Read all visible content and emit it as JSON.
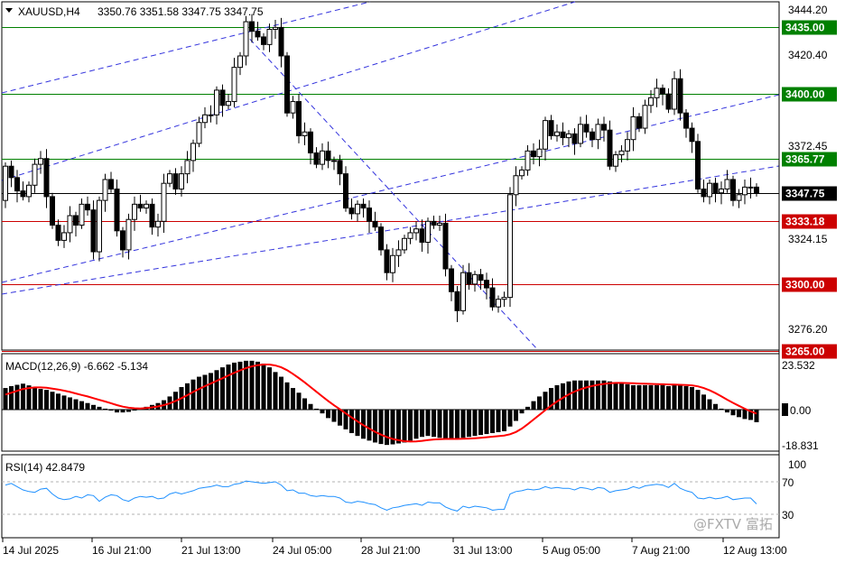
{
  "header": {
    "symbol": "XAUUSD,H4",
    "ohlc": "3350.76 3351.58 3347.75 3347.75"
  },
  "price_axis": {
    "ticks": [
      "3444.20",
      "3420.40",
      "3372.45",
      "3324.15",
      "3276.20"
    ],
    "tagged_levels": [
      {
        "label": "3435.00",
        "value": 3435.0,
        "color": "#008000"
      },
      {
        "label": "3400.00",
        "value": 3400.0,
        "color": "#008000"
      },
      {
        "label": "3365.77",
        "value": 3365.77,
        "color": "#008000"
      },
      {
        "label": "3347.75",
        "value": 3347.75,
        "color": "#000000"
      },
      {
        "label": "3333.18",
        "value": 3333.18,
        "color": "#cc0000"
      },
      {
        "label": "3300.00",
        "value": 3300.0,
        "color": "#cc0000"
      },
      {
        "label": "3265.00",
        "value": 3265.0,
        "color": "#cc0000"
      }
    ]
  },
  "macd_panel": {
    "label": "MACD(12,26,9) -6.662 -5.134",
    "ticks": [
      "23.532",
      "0.00",
      "-18.831"
    ]
  },
  "rsi_panel": {
    "label": "RSI(14) 42.8479",
    "ticks": [
      "100",
      "70",
      "30"
    ]
  },
  "time_axis": {
    "labels": [
      "14 Jul 2025",
      "16 Jul 21:00",
      "21 Jul 13:00",
      "24 Jul 05:00",
      "28 Jul 21:00",
      "31 Jul 13:00",
      "5 Aug 05:00",
      "7 Aug 21:00",
      "12 Aug 13:00"
    ]
  },
  "watermark": "@FXTV 富拓",
  "chart_data": [
    {
      "type": "candlestick",
      "title": "XAUUSD,H4",
      "ylim": [
        3260,
        3448
      ],
      "open": [
        3344,
        3362,
        3356,
        3349,
        3346,
        3352,
        3363,
        3366,
        3346,
        3331,
        3323,
        3327,
        3336,
        3331,
        3342,
        3339,
        3317,
        3344,
        3355,
        3350,
        3328,
        3318,
        3334,
        3342,
        3340,
        3342,
        3330,
        3333,
        3353,
        3358,
        3350,
        3358,
        3365,
        3374,
        3385,
        3389,
        3389,
        3402,
        3394,
        3396,
        3414,
        3420,
        3438,
        3433,
        3430,
        3426,
        3434,
        3435,
        3420,
        3390,
        3396,
        3378,
        3380,
        3369,
        3363,
        3370,
        3365,
        3365,
        3358,
        3340,
        3337,
        3342,
        3340,
        3333,
        3330,
        3318,
        3306,
        3315,
        3318,
        3324,
        3327,
        3329,
        3322,
        3333,
        3331,
        3332,
        3308,
        3296,
        3286,
        3306,
        3300,
        3305,
        3302,
        3298,
        3288,
        3292,
        3293,
        3347,
        3357,
        3360,
        3370,
        3367,
        3371,
        3386,
        3378,
        3380,
        3377,
        3379,
        3374,
        3384,
        3380,
        3376,
        3384,
        3381,
        3362,
        3368,
        3370,
        3376,
        3388,
        3382,
        3394,
        3398,
        3403,
        3400,
        3392,
        3408,
        3390,
        3382,
        3375,
        3350,
        3346,
        3353,
        3348,
        3350,
        3355,
        3344,
        3347,
        3351,
        3351
      ],
      "close": [
        3362,
        3356,
        3349,
        3346,
        3352,
        3363,
        3366,
        3346,
        3331,
        3323,
        3327,
        3336,
        3331,
        3342,
        3339,
        3317,
        3344,
        3355,
        3350,
        3328,
        3318,
        3334,
        3342,
        3340,
        3342,
        3330,
        3333,
        3353,
        3358,
        3350,
        3358,
        3365,
        3374,
        3385,
        3389,
        3389,
        3402,
        3394,
        3396,
        3414,
        3420,
        3438,
        3433,
        3430,
        3426,
        3434,
        3435,
        3420,
        3390,
        3396,
        3378,
        3380,
        3369,
        3363,
        3370,
        3365,
        3365,
        3358,
        3340,
        3337,
        3342,
        3340,
        3333,
        3330,
        3318,
        3306,
        3315,
        3318,
        3324,
        3327,
        3329,
        3322,
        3333,
        3331,
        3332,
        3308,
        3296,
        3286,
        3306,
        3300,
        3305,
        3302,
        3298,
        3288,
        3292,
        3293,
        3347,
        3357,
        3360,
        3370,
        3367,
        3371,
        3386,
        3378,
        3380,
        3377,
        3379,
        3374,
        3384,
        3380,
        3376,
        3384,
        3381,
        3362,
        3368,
        3370,
        3376,
        3388,
        3382,
        3394,
        3398,
        3403,
        3400,
        3392,
        3408,
        3390,
        3382,
        3375,
        3350,
        3346,
        3353,
        3348,
        3350,
        3355,
        3344,
        3347,
        3351,
        3351,
        3348
      ]
    },
    {
      "type": "bar",
      "title": "MACD(12,26,9)",
      "ylim": [
        -24,
        28
      ],
      "values": [
        11.5,
        12.5,
        13.2,
        13.8,
        12.9,
        12.0,
        11.0,
        10.5,
        9.5,
        8.5,
        7.5,
        6.5,
        5.5,
        4.5,
        3.5,
        2.5,
        1.5,
        0.5,
        -0.5,
        -1.5,
        -1.5,
        -1.2,
        -0.5,
        0.5,
        1.5,
        2.5,
        3.5,
        5.0,
        7.0,
        9.5,
        12.0,
        14.0,
        16.0,
        17.5,
        18.5,
        19.5,
        21.0,
        22.5,
        24.0,
        25.0,
        25.5,
        26.0,
        26.0,
        25.5,
        24.5,
        22.5,
        20.0,
        17.5,
        14.5,
        11.5,
        9.0,
        6.0,
        3.0,
        0.5,
        -2.0,
        -4.5,
        -6.5,
        -8.5,
        -10.5,
        -12.5,
        -14.0,
        -15.5,
        -16.5,
        -17.5,
        -18.3,
        -18.8,
        -18.5,
        -18.0,
        -17.5,
        -16.5,
        -15.5,
        -14.5,
        -14.0,
        -14.5,
        -15.0,
        -15.5,
        -15.5,
        -15.5,
        -15.0,
        -14.5,
        -14.0,
        -13.5,
        -13.0,
        -12.5,
        -12.0,
        -11.5,
        -9.0,
        -6.0,
        -2.0,
        1.5,
        4.5,
        7.0,
        9.5,
        11.5,
        13.0,
        14.0,
        15.0,
        15.5,
        15.5,
        15.5,
        15.5,
        15.5,
        15.5,
        15.0,
        14.5,
        14.0,
        13.5,
        13.0,
        13.0,
        13.0,
        13.0,
        13.0,
        13.0,
        12.5,
        13.0,
        13.0,
        12.5,
        12.0,
        10.5,
        8.0,
        5.5,
        3.0,
        0.5,
        -1.5,
        -3.0,
        -4.0,
        -5.0,
        -5.5,
        -6.7
      ],
      "signal": [
        8.0,
        9.0,
        10.0,
        11.0,
        11.5,
        11.8,
        11.8,
        11.6,
        11.2,
        10.7,
        10.1,
        9.4,
        8.6,
        7.8,
        7.0,
        6.1,
        5.2,
        4.3,
        3.4,
        2.4,
        1.6,
        1.0,
        0.7,
        0.6,
        0.8,
        1.2,
        1.7,
        2.4,
        3.3,
        4.6,
        6.1,
        7.7,
        9.4,
        11.0,
        12.5,
        13.9,
        15.3,
        16.7,
        18.2,
        19.6,
        20.9,
        22.1,
        23.0,
        23.7,
        24.0,
        24.0,
        23.5,
        22.5,
        21.0,
        19.0,
        16.8,
        14.5,
        12.0,
        9.5,
        7.0,
        4.6,
        2.3,
        0.2,
        -2.0,
        -4.2,
        -6.3,
        -8.3,
        -10.1,
        -11.8,
        -13.3,
        -14.6,
        -15.6,
        -16.3,
        -16.8,
        -17.0,
        -16.9,
        -16.6,
        -16.2,
        -15.9,
        -15.7,
        -15.6,
        -15.6,
        -15.6,
        -15.5,
        -15.4,
        -15.2,
        -15.0,
        -14.7,
        -14.4,
        -14.1,
        -13.8,
        -13.1,
        -11.9,
        -10.1,
        -7.8,
        -5.3,
        -2.8,
        -0.3,
        2.1,
        4.3,
        6.3,
        8.1,
        9.6,
        10.8,
        11.8,
        12.6,
        13.2,
        13.7,
        14.0,
        14.2,
        14.2,
        14.1,
        14.0,
        13.9,
        13.8,
        13.7,
        13.6,
        13.5,
        13.4,
        13.3,
        13.2,
        13.1,
        12.9,
        12.4,
        11.5,
        10.3,
        8.8,
        7.1,
        5.3,
        3.6,
        2.0,
        0.5,
        -0.9,
        -2.1
      ]
    },
    {
      "type": "line",
      "title": "RSI(14)",
      "ylim": [
        0,
        100
      ],
      "levels": [
        70,
        30
      ],
      "values": [
        66,
        68,
        64,
        60,
        58,
        57,
        61,
        62,
        55,
        50,
        48,
        49,
        52,
        50,
        54,
        53,
        46,
        51,
        54,
        53,
        48,
        46,
        50,
        52,
        51,
        52,
        49,
        50,
        55,
        57,
        55,
        57,
        59,
        62,
        63,
        64,
        66,
        64,
        64,
        67,
        68,
        71,
        70,
        69,
        68,
        69,
        70,
        66,
        59,
        60,
        56,
        56,
        53,
        52,
        53,
        52,
        52,
        50,
        45,
        44,
        46,
        45,
        43,
        42,
        38,
        35,
        38,
        39,
        41,
        42,
        43,
        41,
        45,
        44,
        44,
        39,
        36,
        34,
        40,
        38,
        40,
        39,
        38,
        35,
        36,
        36,
        55,
        58,
        59,
        61,
        60,
        61,
        64,
        62,
        63,
        62,
        62,
        60,
        63,
        62,
        60,
        63,
        62,
        57,
        59,
        60,
        61,
        64,
        62,
        65,
        66,
        67,
        66,
        63,
        68,
        62,
        59,
        57,
        50,
        49,
        51,
        49,
        50,
        52,
        48,
        49,
        50,
        50,
        42.8
      ]
    }
  ]
}
